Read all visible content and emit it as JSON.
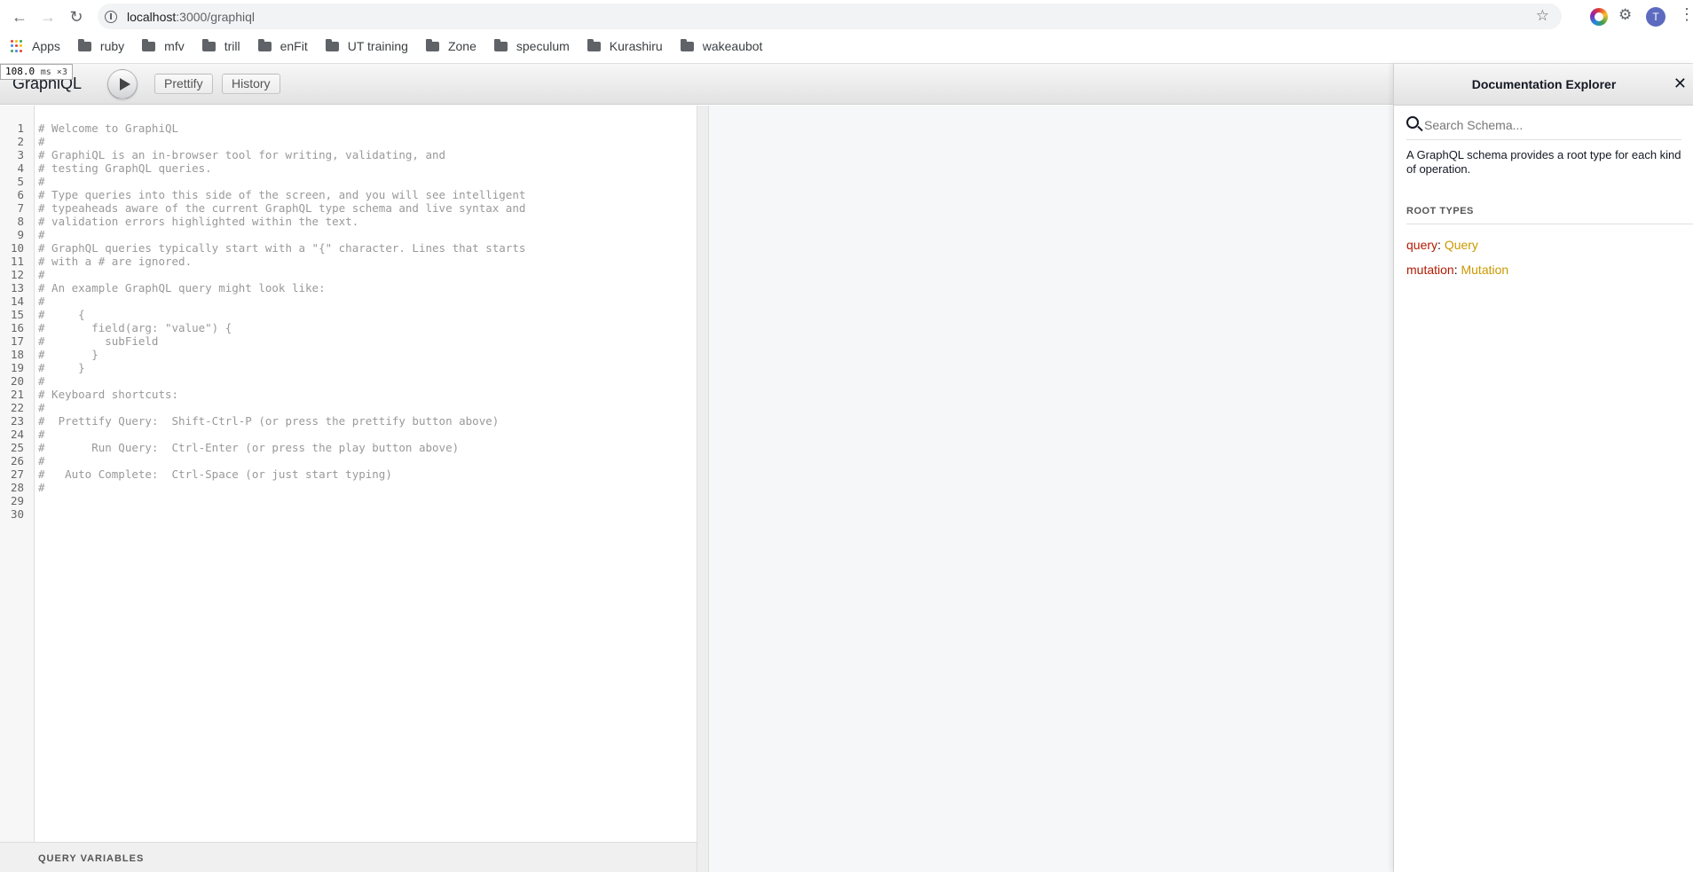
{
  "browser": {
    "url_host": "localhost",
    "url_path": ":3000/graphiql",
    "avatar_letter": "T",
    "bookmarks": [
      "Apps",
      "ruby",
      "mfv",
      "trill",
      "enFit",
      "UT training",
      "Zone",
      "speculum",
      "Kurashiru",
      "wakeaubot"
    ]
  },
  "graphiql": {
    "title": "GraphiQL",
    "perf_value": "108.0",
    "perf_unit": "ms ×3",
    "prettify_label": "Prettify",
    "history_label": "History",
    "query_variables_label": "QUERY VARIABLES",
    "editor_lines": [
      "# Welcome to GraphiQL",
      "#",
      "# GraphiQL is an in-browser tool for writing, validating, and",
      "# testing GraphQL queries.",
      "#",
      "# Type queries into this side of the screen, and you will see intelligent",
      "# typeaheads aware of the current GraphQL type schema and live syntax and",
      "# validation errors highlighted within the text.",
      "#",
      "# GraphQL queries typically start with a \"{\" character. Lines that starts",
      "# with a # are ignored.",
      "#",
      "# An example GraphQL query might look like:",
      "#",
      "#     {",
      "#       field(arg: \"value\") {",
      "#         subField",
      "#       }",
      "#     }",
      "#",
      "# Keyboard shortcuts:",
      "#",
      "#  Prettify Query:  Shift-Ctrl-P (or press the prettify button above)",
      "#",
      "#       Run Query:  Ctrl-Enter (or press the play button above)",
      "#",
      "#   Auto Complete:  Ctrl-Space (or just start typing)",
      "#",
      "",
      ""
    ]
  },
  "docs": {
    "title": "Documentation Explorer",
    "close_glyph": "✕",
    "search_placeholder": "Search Schema...",
    "description": "A GraphQL schema provides a root type for each kind of operation.",
    "root_types_label": "ROOT TYPES",
    "root_types": [
      {
        "field": "query",
        "type": "Query"
      },
      {
        "field": "mutation",
        "type": "Mutation"
      }
    ]
  },
  "colors": {
    "field": "#b11a04",
    "type": "#ca9800",
    "comment": "#999999"
  }
}
